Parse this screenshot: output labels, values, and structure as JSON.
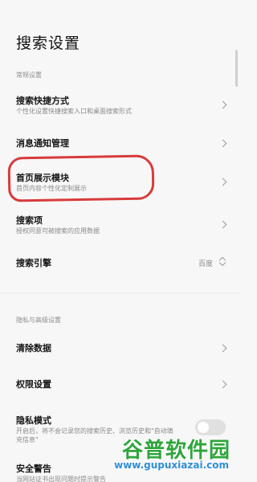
{
  "page_title": "搜索设置",
  "sections": {
    "general": "常规设置",
    "privacy": "隐私与高级设置"
  },
  "rows": {
    "shortcut": {
      "title": "搜索快捷方式",
      "subtitle": "个性化设置快捷搜索入口和桌面搜索形式"
    },
    "notification": {
      "title": "消息通知管理"
    },
    "homepage": {
      "title": "首页展示模块",
      "subtitle": "首页内容个性化定制展示"
    },
    "items": {
      "title": "搜索项",
      "subtitle": "授权同意可被搜索的应用数据"
    },
    "engine": {
      "title": "搜索引擎",
      "value": "百度"
    },
    "clear": {
      "title": "清除数据"
    },
    "permission": {
      "title": "权限设置"
    },
    "privacy_mode": {
      "title": "隐私模式",
      "subtitle_line1": "开启后，将不会记录您的搜索历史、浏览历史和\"自动填",
      "subtitle_line2": "充信息\"",
      "enabled": false
    },
    "security": {
      "title": "安全警告",
      "subtitle": "当网站证书出现问题时提示警告"
    }
  },
  "watermark": {
    "title": "谷普软件园",
    "url": "www.gupuxiazai.com"
  },
  "colors": {
    "highlight": "#d83b3b",
    "watermark_green": "#2fa53c",
    "watermark_blue": "#2e8fd6"
  }
}
